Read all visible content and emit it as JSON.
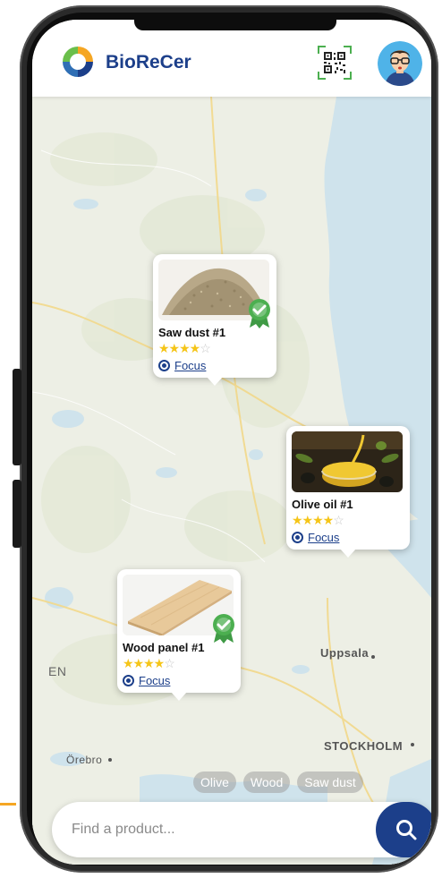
{
  "app": {
    "brand": "BioReCer"
  },
  "header": {
    "qr_icon": "qr-code-icon",
    "avatar_icon": "user-avatar-icon"
  },
  "map": {
    "labels": {
      "uppsala": "Uppsala",
      "stockholm": "STOCKHOLM",
      "orebro": "Örebro",
      "en": "EN"
    }
  },
  "products": [
    {
      "title": "Saw dust #1",
      "rating": 4,
      "max_rating": 5,
      "certified": true,
      "focus_label": "Focus",
      "image": "saw-dust-image"
    },
    {
      "title": "Olive oil #1",
      "rating": 4,
      "max_rating": 5,
      "certified": false,
      "focus_label": "Focus",
      "image": "olive-oil-image"
    },
    {
      "title": "Wood panel #1",
      "rating": 4,
      "max_rating": 5,
      "certified": true,
      "focus_label": "Focus",
      "image": "wood-panel-image"
    }
  ],
  "filters": [
    "Olive",
    "Wood",
    "Saw dust"
  ],
  "search": {
    "placeholder": "Find a product..."
  },
  "colors": {
    "brand": "#1c3f8a",
    "star": "#f5c518",
    "badge": "#4caf50"
  }
}
